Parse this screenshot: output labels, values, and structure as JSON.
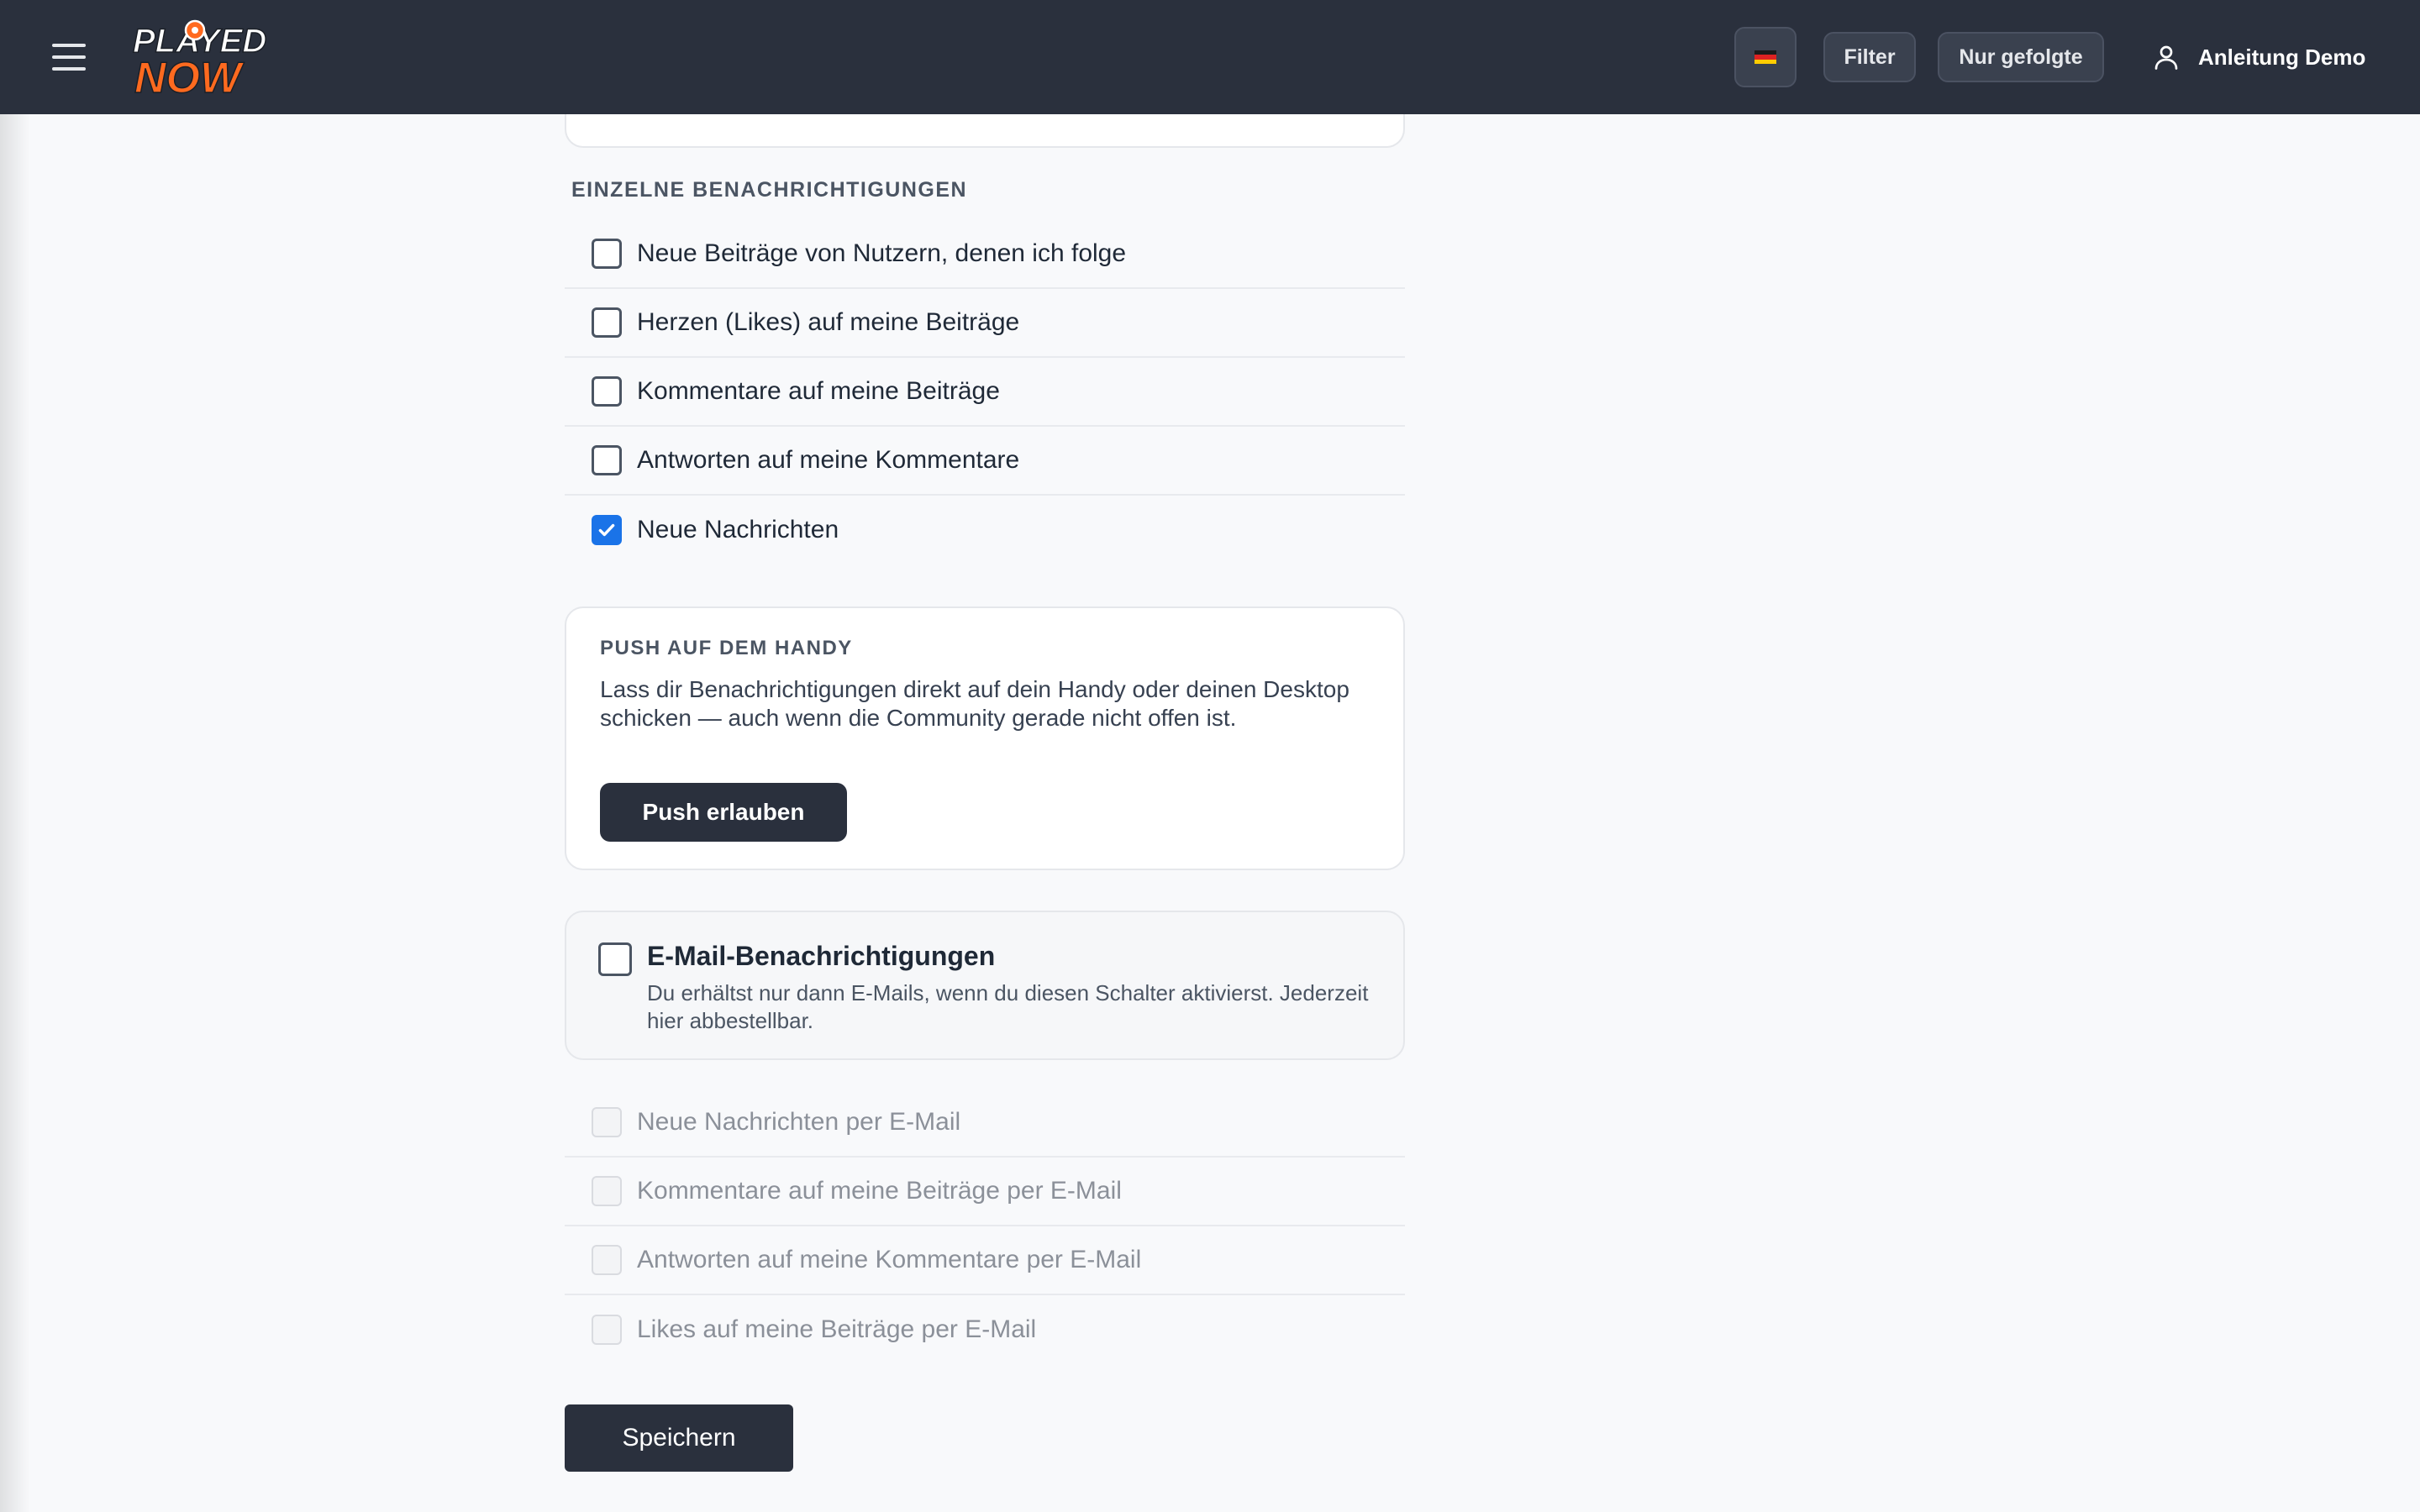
{
  "app": {
    "logo_line1": "PLAYED",
    "logo_line2": "NOW",
    "brand_color": "#ff6a1f"
  },
  "header": {
    "menu_icon": "hamburger-icon",
    "language_flag": "germany-flag",
    "filter_label": "Filter",
    "followed_label": "Nur gefolgte",
    "user_icon": "user-icon",
    "user_name": "Anleitung Demo"
  },
  "notifications": {
    "section_label": "EINZELNE BENACHRICHTIGUNGEN",
    "items": [
      {
        "label": "Neue Beiträge von Nutzern, denen ich folge",
        "checked": false
      },
      {
        "label": "Herzen (Likes) auf meine Beiträge",
        "checked": false
      },
      {
        "label": "Kommentare auf meine Beiträge",
        "checked": false
      },
      {
        "label": "Antworten auf meine Kommentare",
        "checked": false
      },
      {
        "label": "Neue Nachrichten",
        "checked": true
      }
    ]
  },
  "push": {
    "title": "PUSH AUF DEM HANDY",
    "description": "Lass dir Benachrichtigungen direkt auf dein Handy oder deinen Desktop schicken — auch wenn die Community gerade nicht offen ist.",
    "button_label": "Push erlauben"
  },
  "email": {
    "title": "E-Mail-Benachrichtigungen",
    "description": "Du erhältst nur dann E-Mails, wenn du diesen Schalter aktivierst. Jederzeit hier abbestellbar.",
    "enabled": false,
    "items": [
      {
        "label": "Neue Nachrichten per E-Mail",
        "checked": false,
        "disabled": true
      },
      {
        "label": "Kommentare auf meine Beiträge per E-Mail",
        "checked": false,
        "disabled": true
      },
      {
        "label": "Antworten auf meine Kommentare per E-Mail",
        "checked": false,
        "disabled": true
      },
      {
        "label": "Likes auf meine Beiträge per E-Mail",
        "checked": false,
        "disabled": true
      }
    ]
  },
  "save_label": "Speichern",
  "colors": {
    "topbar": "#2a303d",
    "checkbox_checked": "#1a73e8",
    "page_background": "#f8f9fb"
  }
}
